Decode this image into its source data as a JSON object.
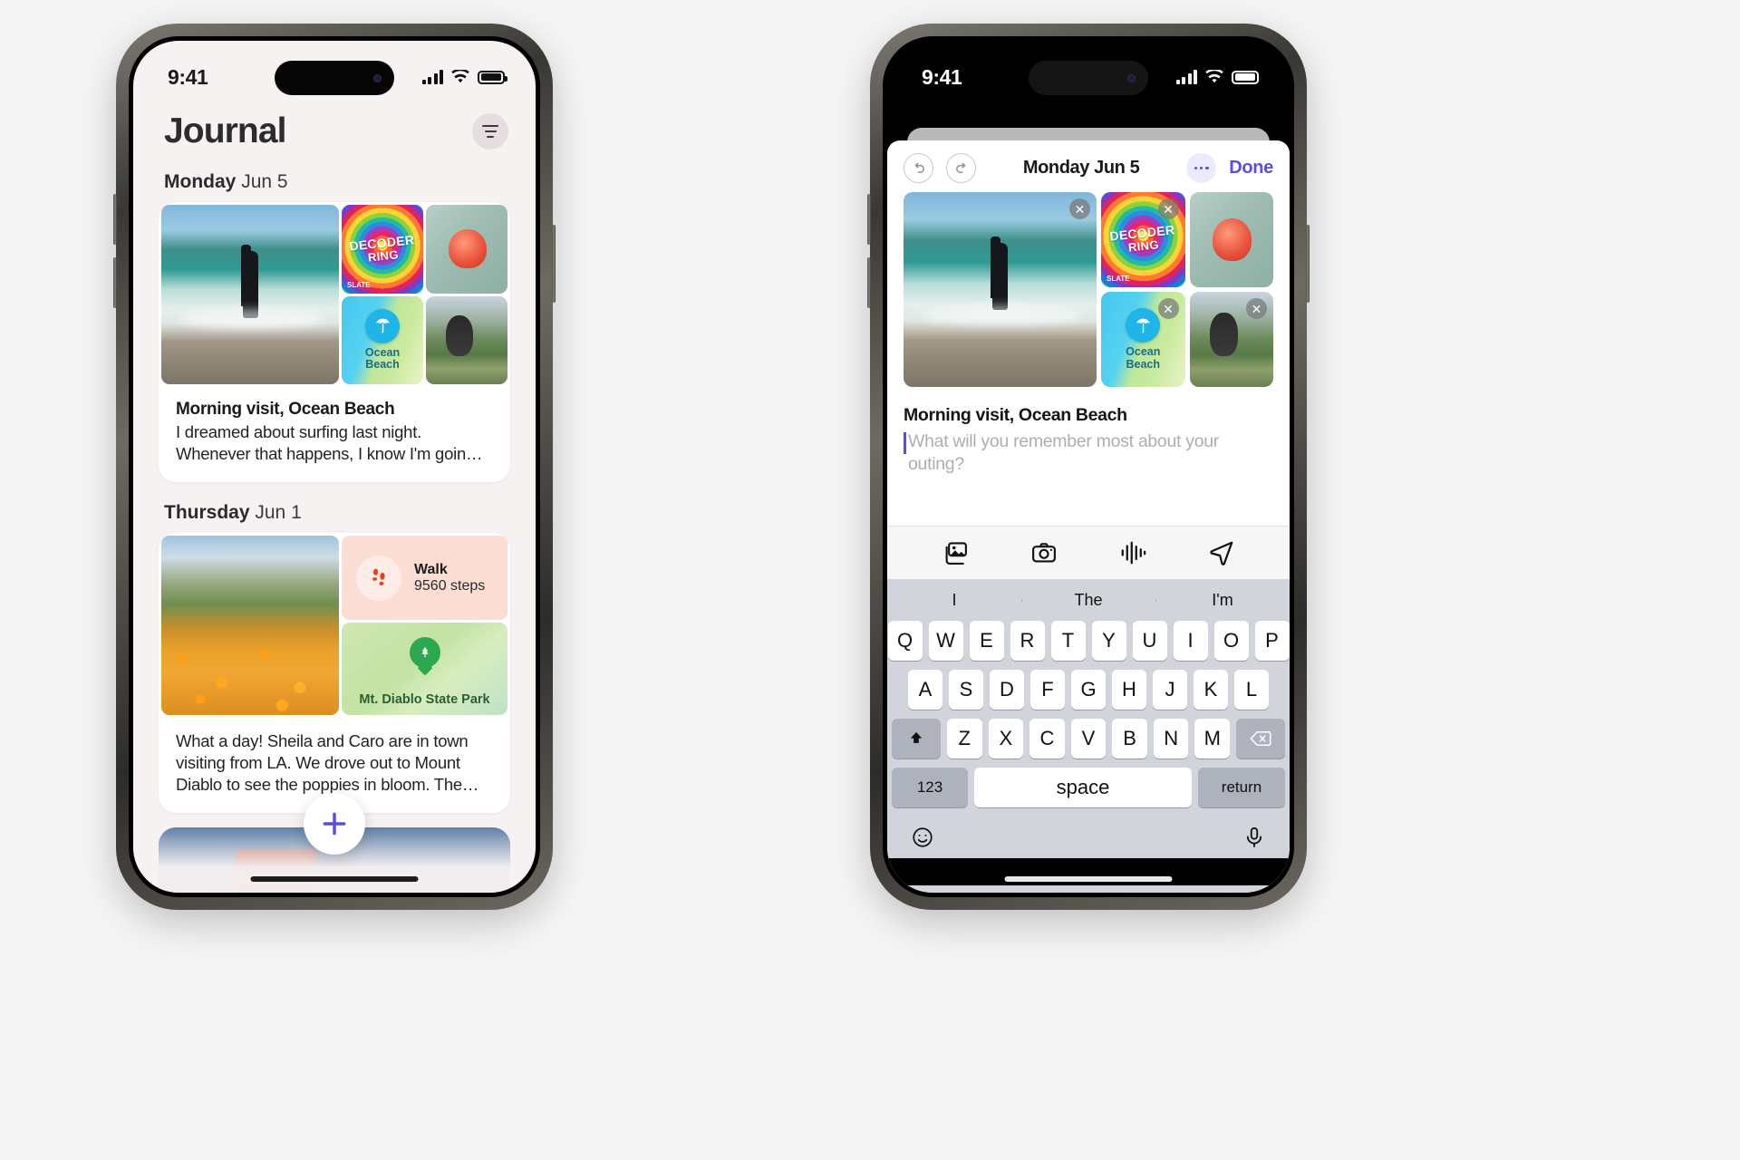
{
  "left_phone": {
    "status": {
      "time": "9:41",
      "signal_icon": "cellular-bars-icon",
      "wifi_icon": "wifi-icon",
      "battery_icon": "battery-icon"
    },
    "app_title": "Journal",
    "filter_button": "filter-icon",
    "sections": [
      {
        "day_name": "Monday",
        "day_date": "Jun 5",
        "entry": {
          "title": "Morning visit, Ocean Beach",
          "body_line1": "I dreamed about surfing last night.",
          "body_line2": "Whenever that happens, I know I'm goin…",
          "media": {
            "photo_main": "surfer-beach-photo",
            "album_art_line1": "DECODER",
            "album_art_line2": "RING",
            "album_art_badge": "SLATE",
            "photo_shell": "shell-on-towel-photo",
            "map_label_line1": "Ocean",
            "map_label_line2": "Beach",
            "photo_dog": "dog-in-car-photo"
          }
        }
      },
      {
        "day_name": "Thursday",
        "day_date": "Jun 1",
        "entry": {
          "body_line1": "What a day! Sheila and Caro are in town",
          "body_line2": "visiting from LA. We drove out to Mount",
          "body_line3": "Diablo to see the poppies in bloom. The…",
          "media": {
            "photo_poppies": "poppy-field-photo",
            "workout_title": "Walk",
            "workout_value": "9560 steps",
            "workout_icon": "footprints-icon",
            "park_label": "Mt. Diablo State Park",
            "park_icon": "park-tree-icon"
          }
        }
      }
    ],
    "new_entry_button": "plus-icon"
  },
  "right_phone": {
    "status": {
      "time": "9:41",
      "signal_icon": "cellular-bars-icon",
      "wifi_icon": "wifi-icon",
      "battery_icon": "battery-icon"
    },
    "nav": {
      "undo_icon": "undo-icon",
      "redo_icon": "redo-icon",
      "date_title": "Monday Jun 5",
      "more_icon": "ellipsis-icon",
      "done_label": "Done"
    },
    "media": {
      "photo_main": "surfer-beach-photo",
      "album_art_line1": "DECODER",
      "album_art_line2": "RING",
      "album_art_badge": "SLATE",
      "photo_shell": "shell-on-towel-photo",
      "map_label_line1": "Ocean",
      "map_label_line2": "Beach",
      "photo_dog": "dog-in-car-photo",
      "remove_glyph": "✕"
    },
    "editor": {
      "title": "Morning visit, Ocean Beach",
      "placeholder": "What will you remember most about your outing?"
    },
    "toolbar": {
      "photos_icon": "photo-library-icon",
      "camera_icon": "camera-icon",
      "audio_icon": "waveform-icon",
      "location_icon": "location-arrow-icon"
    },
    "keyboard": {
      "suggestions": [
        "I",
        "The",
        "I'm"
      ],
      "row1": [
        "Q",
        "W",
        "E",
        "R",
        "T",
        "Y",
        "U",
        "I",
        "O",
        "P"
      ],
      "row2": [
        "A",
        "S",
        "D",
        "F",
        "G",
        "H",
        "J",
        "K",
        "L"
      ],
      "row3": [
        "Z",
        "X",
        "C",
        "V",
        "B",
        "N",
        "M"
      ],
      "shift_icon": "shift-icon",
      "backspace_icon": "backspace-icon",
      "numbers_label": "123",
      "space_label": "space",
      "return_label": "return",
      "emoji_icon": "emoji-icon",
      "mic_icon": "microphone-icon"
    }
  },
  "colors": {
    "accent": "#5b4de0",
    "journal_bg": "#f7f2f2",
    "keyboard_bg": "#d2d4dc",
    "workout_bg": "#fbddd3",
    "park_bg": "#cfe8b2"
  }
}
